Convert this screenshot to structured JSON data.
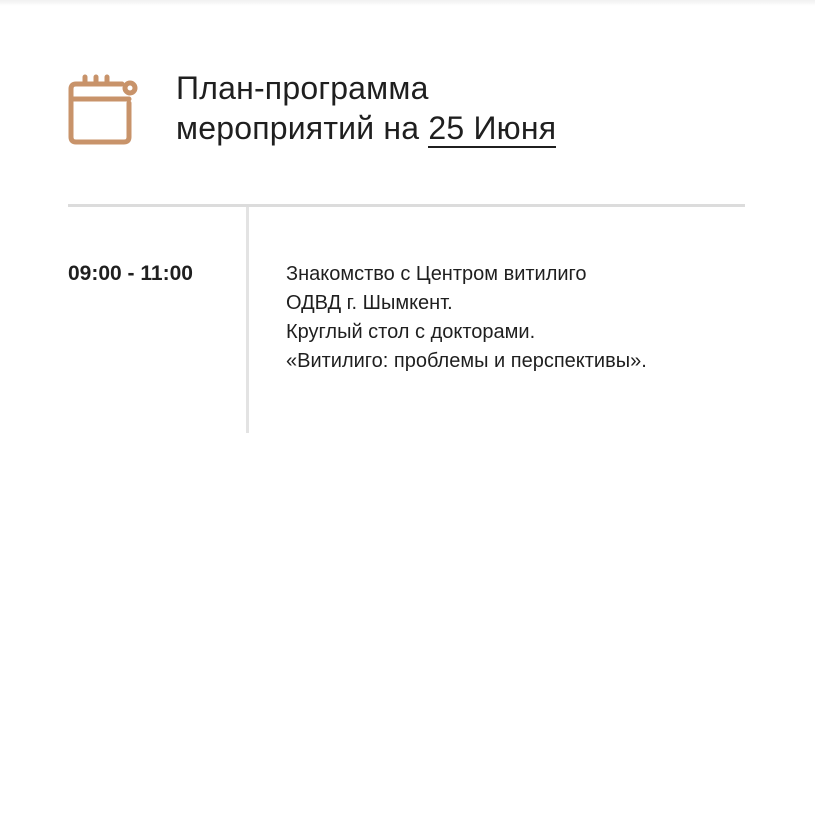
{
  "header": {
    "icon": "calendar-icon",
    "icon_color": "#c8936a",
    "title_line1": "План-программа",
    "title_line2_prefix": "мероприятий на ",
    "title_date": "25 Июня"
  },
  "schedule": [
    {
      "time": "09:00 - 11:00",
      "lines": [
        "Знакомство с Центром витилиго",
        "ОДВД г. Шымкент.",
        "Круглый стол с докторами.",
        "«Витилиго: проблемы и перспективы»."
      ]
    }
  ]
}
